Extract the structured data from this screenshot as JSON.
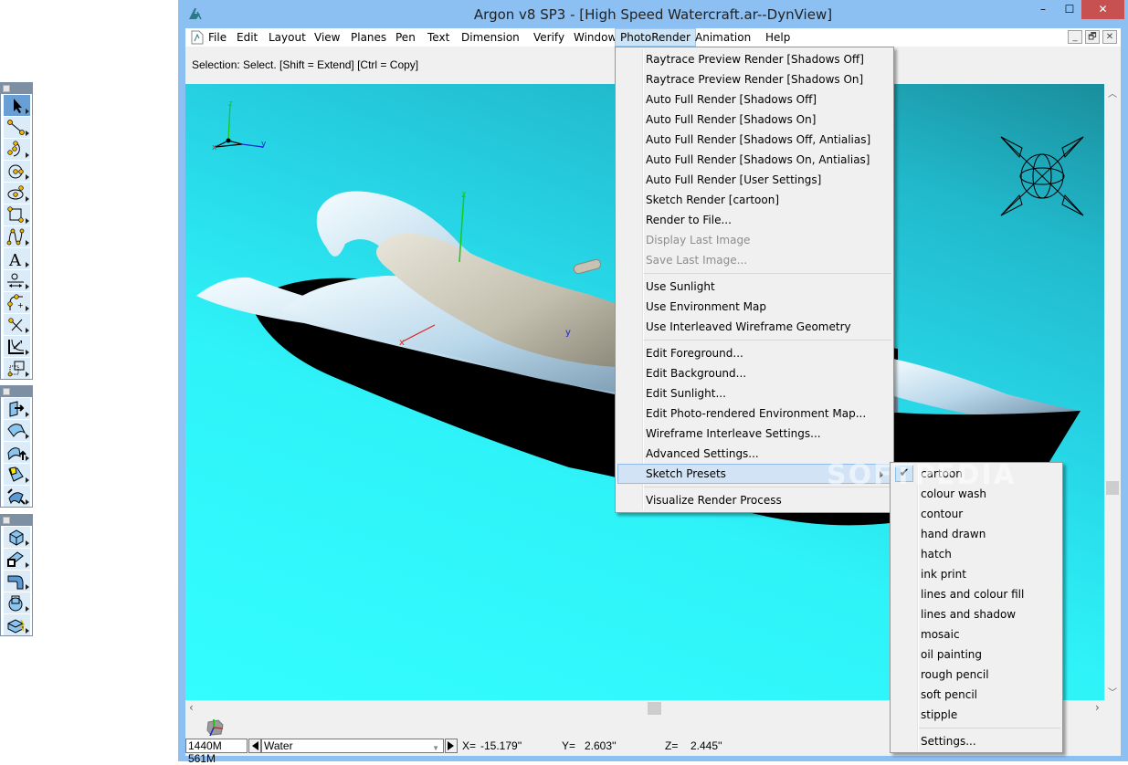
{
  "window": {
    "title": "Argon v8 SP3 - [High Speed Watercraft.ar--DynView]",
    "controls": {
      "minimize": "–",
      "maximize": "☐",
      "close": "✕"
    },
    "mdi_controls": {
      "minimize": "_",
      "restore": "🗗",
      "close": "✕"
    }
  },
  "menubar": {
    "items": [
      "File",
      "Edit",
      "Layout",
      "View",
      "Planes",
      "Pen",
      "Text",
      "Dimension",
      "Verify",
      "Window",
      "PhotoRender",
      "Animation",
      "Help"
    ],
    "open_item": "PhotoRender"
  },
  "status_hint": "Selection: Select. [Shift = Extend] [Ctrl = Copy]",
  "photorender_menu": {
    "groups": [
      [
        {
          "label": "Raytrace Preview Render [Shadows Off]",
          "enabled": true
        },
        {
          "label": "Raytrace Preview Render [Shadows On]",
          "enabled": true
        },
        {
          "label": "Auto Full Render [Shadows Off]",
          "enabled": true
        },
        {
          "label": "Auto Full Render [Shadows On]",
          "enabled": true
        },
        {
          "label": "Auto Full Render [Shadows Off, Antialias]",
          "enabled": true
        },
        {
          "label": "Auto Full Render [Shadows On, Antialias]",
          "enabled": true
        },
        {
          "label": "Auto Full Render [User Settings]",
          "enabled": true
        },
        {
          "label": "Sketch Render [cartoon]",
          "enabled": true
        },
        {
          "label": "Render to File...",
          "enabled": true
        },
        {
          "label": "Display Last Image",
          "enabled": false
        },
        {
          "label": "Save Last Image...",
          "enabled": false
        }
      ],
      [
        {
          "label": "Use Sunlight",
          "enabled": true
        },
        {
          "label": "Use Environment Map",
          "enabled": true
        },
        {
          "label": "Use Interleaved Wireframe Geometry",
          "enabled": true
        }
      ],
      [
        {
          "label": "Edit Foreground...",
          "enabled": true
        },
        {
          "label": "Edit Background...",
          "enabled": true
        },
        {
          "label": "Edit Sunlight...",
          "enabled": true
        },
        {
          "label": "Edit Photo-rendered Environment Map...",
          "enabled": true
        },
        {
          "label": "Wireframe Interleave Settings...",
          "enabled": true
        },
        {
          "label": "Advanced Settings...",
          "enabled": true
        },
        {
          "label": "Sketch Presets",
          "enabled": true,
          "submenu": true,
          "highlighted": true
        }
      ],
      [
        {
          "label": "Visualize Render Process",
          "enabled": true
        }
      ]
    ]
  },
  "sketch_presets_menu": {
    "items": [
      "cartoon",
      "colour wash",
      "contour",
      "hand drawn",
      "hatch",
      "ink print",
      "lines and colour fill",
      "lines and shadow",
      "mosaic",
      "oil painting",
      "rough pencil",
      "soft pencil",
      "stipple"
    ],
    "checked": "cartoon",
    "footer": "Settings..."
  },
  "viewport": {
    "axis_labels": {
      "x": "x",
      "y": "y",
      "z": "z"
    },
    "colors": {
      "x_axis": "#e0201c",
      "y_axis": "#1a23d6",
      "z_axis": "#18c81c",
      "background_top": "#1a8e9c",
      "background_bottom": "#33fdff"
    }
  },
  "statusbar": {
    "memory_total": "1440M",
    "memory_used": "561M",
    "layer": "Water",
    "x_label": "X=",
    "x_value": "-15.179''",
    "y_label": "Y=",
    "y_value": "2.603''",
    "z_label": "Z=",
    "z_value": "2.445''"
  },
  "watermark": "SOFTPEDIA",
  "toolboxes": [
    {
      "name": "drawing-tools",
      "tools": [
        "select",
        "line",
        "arc-3-point",
        "circle",
        "ellipse",
        "rectangle",
        "spline",
        "text",
        "dimension",
        "fillet",
        "trim",
        "move-rotate",
        "region-select"
      ],
      "active": "select"
    },
    {
      "name": "surface-tools",
      "tools": [
        "extrude-surface",
        "loft-surface",
        "sweep-surface",
        "patch-surface",
        "blend-surface"
      ]
    },
    {
      "name": "solid-tools",
      "tools": [
        "box-solid",
        "extrude-solid",
        "sweep-solid",
        "revolve-solid",
        "boolean-solid"
      ]
    }
  ]
}
